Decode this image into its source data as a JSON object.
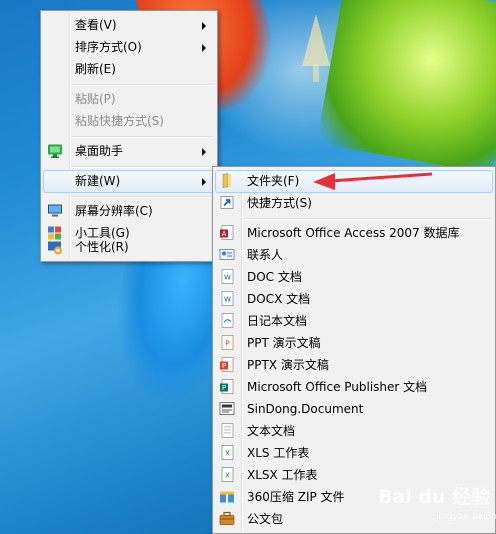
{
  "context_menu": {
    "items": [
      {
        "label": "查看(V)"
      },
      {
        "label": "排序方式(O)"
      },
      {
        "label": "刷新(E)"
      },
      {
        "label": "粘贴(P)"
      },
      {
        "label": "粘贴快捷方式(S)"
      },
      {
        "label": "桌面助手"
      },
      {
        "label": "新建(W)"
      },
      {
        "label": "屏幕分辨率(C)"
      },
      {
        "label": "小工具(G)"
      },
      {
        "label": "个性化(R)"
      }
    ]
  },
  "new_submenu": {
    "items": [
      {
        "label": "文件夹(F)",
        "icon": "folder-icon"
      },
      {
        "label": "快捷方式(S)",
        "icon": "shortcut-icon"
      },
      {
        "label": "Microsoft Office Access 2007 数据库",
        "icon": "access-database-icon"
      },
      {
        "label": "联系人",
        "icon": "contact-icon"
      },
      {
        "label": "DOC 文档",
        "icon": "doc-icon"
      },
      {
        "label": "DOCX 文档",
        "icon": "docx-icon"
      },
      {
        "label": "日记本文档",
        "icon": "journal-icon"
      },
      {
        "label": "PPT 演示文稿",
        "icon": "ppt-icon"
      },
      {
        "label": "PPTX 演示文稿",
        "icon": "pptx-icon"
      },
      {
        "label": "Microsoft Office Publisher 文档",
        "icon": "publisher-icon"
      },
      {
        "label": "SinDong.Document",
        "icon": "sindong-document-icon"
      },
      {
        "label": "文本文档",
        "icon": "text-document-icon"
      },
      {
        "label": "XLS 工作表",
        "icon": "xls-icon"
      },
      {
        "label": "XLSX 工作表",
        "icon": "xlsx-icon"
      },
      {
        "label": "360压缩 ZIP 文件",
        "icon": "zip-archive-icon"
      },
      {
        "label": "公文包",
        "icon": "briefcase-icon"
      }
    ]
  },
  "watermark": {
    "text": "Bai du 经验",
    "sub": "jingyan.baidu.com"
  },
  "colors": {
    "highlight_border": "#aecff7",
    "annotation_arrow": "#e8303a",
    "menu_background": "#f1f1f1"
  }
}
